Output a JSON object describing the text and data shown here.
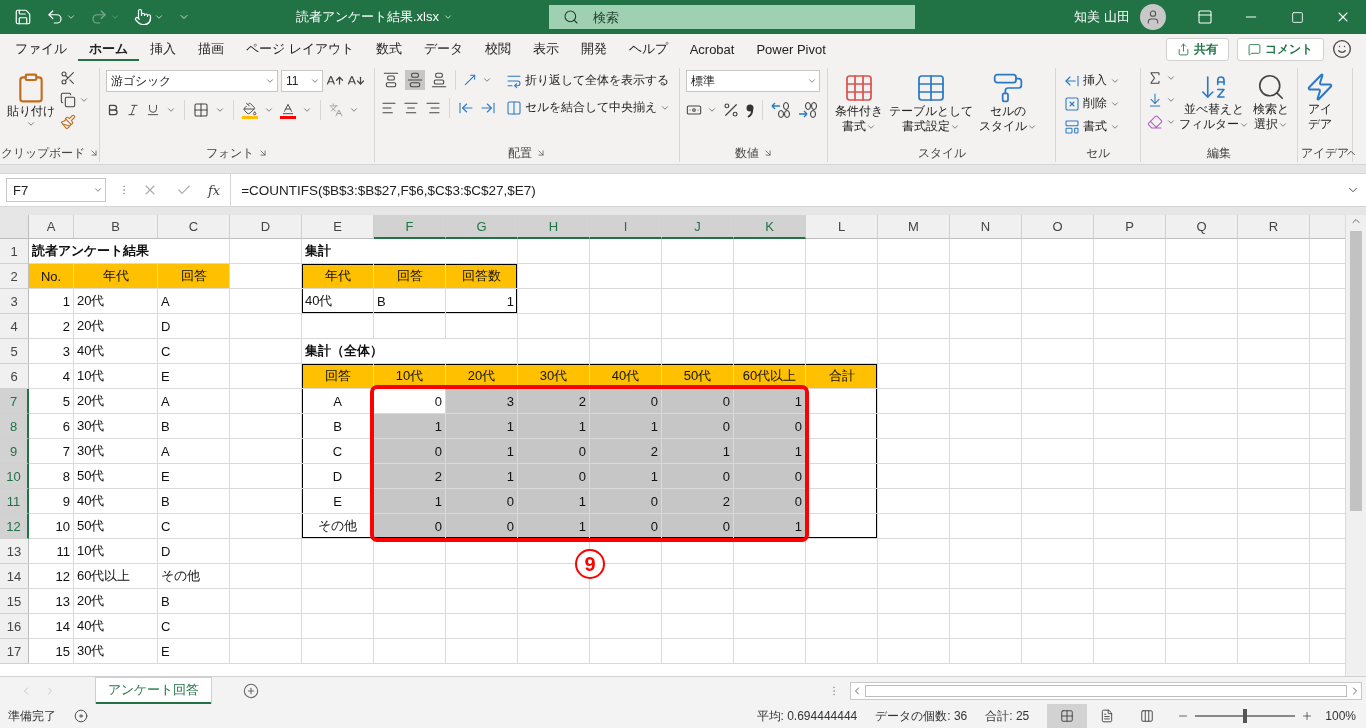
{
  "title_bar": {
    "quick_access": [
      {
        "kind": "save",
        "disabled": false
      },
      {
        "kind": "undo",
        "disabled": false
      },
      {
        "kind": "redo",
        "disabled": true
      },
      {
        "kind": "touch",
        "disabled": false
      },
      {
        "kind": "customize",
        "disabled": false
      }
    ],
    "title": "読者アンケート結果.xlsx",
    "search": {
      "placeholder": "検索"
    },
    "user": "知美 山田"
  },
  "ribbon_tabs": [
    {
      "label": "ファイル",
      "selected": false
    },
    {
      "label": "ホーム",
      "selected": true
    },
    {
      "label": "挿入",
      "selected": false
    },
    {
      "label": "描画",
      "selected": false
    },
    {
      "label": "ページ レイアウト",
      "selected": false
    },
    {
      "label": "数式",
      "selected": false
    },
    {
      "label": "データ",
      "selected": false
    },
    {
      "label": "校閲",
      "selected": false
    },
    {
      "label": "表示",
      "selected": false
    },
    {
      "label": "開発",
      "selected": false
    },
    {
      "label": "ヘルプ",
      "selected": false
    },
    {
      "label": "Acrobat",
      "selected": false
    },
    {
      "label": "Power Pivot",
      "selected": false
    }
  ],
  "share": "共有",
  "comment": "コメント",
  "ribbon": {
    "clipboard": {
      "paste": "貼り付け",
      "label": "クリップボード"
    },
    "font": {
      "name": "游ゴシック",
      "size": "11",
      "label": "フォント"
    },
    "alignment": {
      "vertical": [
        {
          "kind": "top",
          "selected": false
        },
        {
          "kind": "middle",
          "selected": true
        },
        {
          "kind": "bottom",
          "selected": false
        }
      ],
      "wrap": "折り返して全体を表示する",
      "merge": "セルを結合して中央揃え",
      "label": "配置"
    },
    "number": {
      "format": "標準",
      "label": "数値"
    },
    "styles": {
      "buttons": [
        {
          "lines": [
            "条件付き",
            "書式"
          ]
        },
        {
          "lines": [
            "テーブルとして",
            "書式設定"
          ]
        },
        {
          "lines": [
            "セルの",
            "スタイル"
          ]
        }
      ],
      "label": "スタイル"
    },
    "cells": {
      "buttons": [
        "挿入",
        "削除",
        "書式"
      ],
      "label": "セル"
    },
    "editing": {
      "buttons": [
        {
          "lines": [
            "並べ替えと",
            "フィルター"
          ]
        },
        {
          "lines": [
            "検索と",
            "選択"
          ]
        }
      ],
      "label": "編集"
    },
    "ideas": {
      "lines": [
        "アイ",
        "デア"
      ],
      "label": "アイデア"
    }
  },
  "formula_bar": {
    "name_box": "F7",
    "fx": "fx",
    "formula": "=COUNTIFS($B$3:$B$27,F$6,$C$3:$C$27,$E7)"
  },
  "sheet": {
    "columns": [
      {
        "label": "A",
        "selected": false
      },
      {
        "label": "B",
        "selected": false
      },
      {
        "label": "C",
        "selected": false
      },
      {
        "label": "D",
        "selected": false
      },
      {
        "label": "E",
        "selected": false
      },
      {
        "label": "F",
        "selected": true
      },
      {
        "label": "G",
        "selected": true
      },
      {
        "label": "H",
        "selected": true
      },
      {
        "label": "I",
        "selected": true
      },
      {
        "label": "J",
        "selected": true
      },
      {
        "label": "K",
        "selected": true
      },
      {
        "label": "L",
        "selected": false
      },
      {
        "label": "M",
        "selected": false
      },
      {
        "label": "N",
        "selected": false
      },
      {
        "label": "O",
        "selected": false
      },
      {
        "label": "P",
        "selected": false
      },
      {
        "label": "Q",
        "selected": false
      },
      {
        "label": "R",
        "selected": false
      }
    ],
    "rows": [
      {
        "label": "1",
        "selected": false,
        "cells": [
          {
            "text": "読者アンケート結果",
            "kind": "title"
          },
          null,
          null,
          null,
          {
            "text": "集計",
            "kind": "title"
          }
        ]
      },
      {
        "label": "2",
        "selected": false,
        "cells": [
          {
            "text": "No.",
            "kind": "header"
          },
          {
            "text": "年代",
            "kind": "header"
          },
          {
            "text": "回答",
            "kind": "header"
          },
          null,
          {
            "text": "年代",
            "kind": "header",
            "edge_top": true,
            "edge_left": true
          },
          {
            "text": "回答",
            "kind": "header",
            "edge_top": true
          },
          {
            "text": "回答数",
            "kind": "header",
            "edge_top": true,
            "edge_right": true
          }
        ]
      },
      {
        "label": "3",
        "selected": false,
        "cells": [
          {
            "text": "1",
            "kind": "number"
          },
          {
            "text": "20代",
            "kind": "text"
          },
          {
            "text": "A",
            "kind": "text"
          },
          null,
          {
            "text": "40代",
            "kind": "text",
            "edge_bottom": true,
            "edge_left": true
          },
          {
            "text": "B",
            "kind": "text",
            "edge_bottom": true
          },
          {
            "text": "1",
            "kind": "number",
            "edge_bottom": true,
            "edge_right": true
          }
        ]
      },
      {
        "label": "4",
        "selected": false,
        "cells": [
          {
            "text": "2",
            "kind": "number"
          },
          {
            "text": "20代",
            "kind": "text"
          },
          {
            "text": "D",
            "kind": "text"
          }
        ]
      },
      {
        "label": "5",
        "selected": false,
        "cells": [
          {
            "text": "3",
            "kind": "number"
          },
          {
            "text": "40代",
            "kind": "text"
          },
          {
            "text": "C",
            "kind": "text"
          },
          null,
          {
            "text": "集計（全体）",
            "kind": "title"
          }
        ]
      },
      {
        "label": "6",
        "selected": false,
        "cells": [
          {
            "text": "4",
            "kind": "number"
          },
          {
            "text": "10代",
            "kind": "text"
          },
          {
            "text": "E",
            "kind": "text"
          },
          null,
          {
            "text": "回答",
            "kind": "header",
            "edge_top": true,
            "edge_left": true
          },
          {
            "text": "10代",
            "kind": "header",
            "edge_top": true
          },
          {
            "text": "20代",
            "kind": "header",
            "edge_top": true
          },
          {
            "text": "30代",
            "kind": "header",
            "edge_top": true
          },
          {
            "text": "40代",
            "kind": "header",
            "edge_top": true
          },
          {
            "text": "50代",
            "kind": "header",
            "edge_top": true
          },
          {
            "text": "60代以上",
            "kind": "header",
            "edge_top": true
          },
          {
            "text": "合計",
            "kind": "header",
            "edge_top": true,
            "edge_right": true
          }
        ]
      },
      {
        "label": "7",
        "selected": true,
        "cells": [
          {
            "text": "5",
            "kind": "number"
          },
          {
            "text": "20代",
            "kind": "text"
          },
          {
            "text": "A",
            "kind": "text"
          },
          null,
          {
            "text": "A",
            "kind": "center",
            "edge_left": true
          },
          {
            "text": "0",
            "kind": "number",
            "selected": false
          },
          {
            "text": "3",
            "kind": "number",
            "selected": true
          },
          {
            "text": "2",
            "kind": "number",
            "selected": true
          },
          {
            "text": "0",
            "kind": "number",
            "selected": true
          },
          {
            "text": "0",
            "kind": "number",
            "selected": true
          },
          {
            "text": "1",
            "kind": "number",
            "selected": true
          },
          {
            "edge_right": true
          }
        ]
      },
      {
        "label": "8",
        "selected": true,
        "cells": [
          {
            "text": "6",
            "kind": "number"
          },
          {
            "text": "30代",
            "kind": "text"
          },
          {
            "text": "B",
            "kind": "text"
          },
          null,
          {
            "text": "B",
            "kind": "center",
            "edge_left": true
          },
          {
            "text": "1",
            "kind": "number",
            "selected": true
          },
          {
            "text": "1",
            "kind": "number",
            "selected": true
          },
          {
            "text": "1",
            "kind": "number",
            "selected": true
          },
          {
            "text": "1",
            "kind": "number",
            "selected": true
          },
          {
            "text": "0",
            "kind": "number",
            "selected": true
          },
          {
            "text": "0",
            "kind": "number",
            "selected": true
          },
          {
            "edge_right": true
          }
        ]
      },
      {
        "label": "9",
        "selected": true,
        "cells": [
          {
            "text": "7",
            "kind": "number"
          },
          {
            "text": "30代",
            "kind": "text"
          },
          {
            "text": "A",
            "kind": "text"
          },
          null,
          {
            "text": "C",
            "kind": "center",
            "edge_left": true
          },
          {
            "text": "0",
            "kind": "number",
            "selected": true
          },
          {
            "text": "1",
            "kind": "number",
            "selected": true
          },
          {
            "text": "0",
            "kind": "number",
            "selected": true
          },
          {
            "text": "2",
            "kind": "number",
            "selected": true
          },
          {
            "text": "1",
            "kind": "number",
            "selected": true
          },
          {
            "text": "1",
            "kind": "number",
            "selected": true
          },
          {
            "edge_right": true
          }
        ]
      },
      {
        "label": "10",
        "selected": true,
        "cells": [
          {
            "text": "8",
            "kind": "number"
          },
          {
            "text": "50代",
            "kind": "text"
          },
          {
            "text": "E",
            "kind": "text"
          },
          null,
          {
            "text": "D",
            "kind": "center",
            "edge_left": true
          },
          {
            "text": "2",
            "kind": "number",
            "selected": true
          },
          {
            "text": "1",
            "kind": "number",
            "selected": true
          },
          {
            "text": "0",
            "kind": "number",
            "selected": true
          },
          {
            "text": "1",
            "kind": "number",
            "selected": true
          },
          {
            "text": "0",
            "kind": "number",
            "selected": true
          },
          {
            "text": "0",
            "kind": "number",
            "selected": true
          },
          {
            "edge_right": true
          }
        ]
      },
      {
        "label": "11",
        "selected": true,
        "cells": [
          {
            "text": "9",
            "kind": "number"
          },
          {
            "text": "40代",
            "kind": "text"
          },
          {
            "text": "B",
            "kind": "text"
          },
          null,
          {
            "text": "E",
            "kind": "center",
            "edge_left": true
          },
          {
            "text": "1",
            "kind": "number",
            "selected": true
          },
          {
            "text": "0",
            "kind": "number",
            "selected": true
          },
          {
            "text": "1",
            "kind": "number",
            "selected": true
          },
          {
            "text": "0",
            "kind": "number",
            "selected": true
          },
          {
            "text": "2",
            "kind": "number",
            "selected": true
          },
          {
            "text": "0",
            "kind": "number",
            "selected": true
          },
          {
            "edge_right": true
          }
        ]
      },
      {
        "label": "12",
        "selected": true,
        "cells": [
          {
            "text": "10",
            "kind": "number"
          },
          {
            "text": "50代",
            "kind": "text"
          },
          {
            "text": "C",
            "kind": "text"
          },
          null,
          {
            "text": "その他",
            "kind": "center",
            "edge_bottom": true,
            "edge_left": true
          },
          {
            "text": "0",
            "kind": "number",
            "selected": true,
            "edge_bottom": true
          },
          {
            "text": "0",
            "kind": "number",
            "selected": true,
            "edge_bottom": true
          },
          {
            "text": "1",
            "kind": "number",
            "selected": true,
            "edge_bottom": true
          },
          {
            "text": "0",
            "kind": "number",
            "selected": true,
            "edge_bottom": true
          },
          {
            "text": "0",
            "kind": "number",
            "selected": true,
            "edge_bottom": true
          },
          {
            "text": "1",
            "kind": "number",
            "selected": true,
            "edge_bottom": true
          },
          {
            "edge_bottom": true,
            "edge_right": true
          }
        ]
      },
      {
        "label": "13",
        "selected": false,
        "cells": [
          {
            "text": "11",
            "kind": "number"
          },
          {
            "text": "10代",
            "kind": "text"
          },
          {
            "text": "D",
            "kind": "text"
          }
        ]
      },
      {
        "label": "14",
        "selected": false,
        "cells": [
          {
            "text": "12",
            "kind": "number"
          },
          {
            "text": "60代以上",
            "kind": "text"
          },
          {
            "text": "その他",
            "kind": "text"
          }
        ]
      },
      {
        "label": "15",
        "selected": false,
        "cells": [
          {
            "text": "13",
            "kind": "number"
          },
          {
            "text": "20代",
            "kind": "text"
          },
          {
            "text": "B",
            "kind": "text"
          }
        ]
      },
      {
        "label": "16",
        "selected": false,
        "cells": [
          {
            "text": "14",
            "kind": "number"
          },
          {
            "text": "40代",
            "kind": "text"
          },
          {
            "text": "C",
            "kind": "text"
          }
        ]
      },
      {
        "label": "17",
        "selected": false,
        "cells": [
          {
            "text": "15",
            "kind": "number"
          },
          {
            "text": "30代",
            "kind": "text"
          },
          {
            "text": "E",
            "kind": "text"
          }
        ]
      }
    ]
  },
  "annotation": {
    "label": "9"
  },
  "sheet_tabs": [
    {
      "label": "アンケート回答",
      "selected": true
    }
  ],
  "status_bar": {
    "status": "準備完了",
    "average": "平均: 0.694444444",
    "count": "データの個数: 36",
    "sum": "合計: 25",
    "views": [
      {
        "kind": "normal",
        "selected": true
      },
      {
        "kind": "page_layout",
        "selected": false
      },
      {
        "kind": "page_break",
        "selected": false
      }
    ],
    "zoom": {
      "level": 0.5,
      "reading": "100%"
    }
  }
}
